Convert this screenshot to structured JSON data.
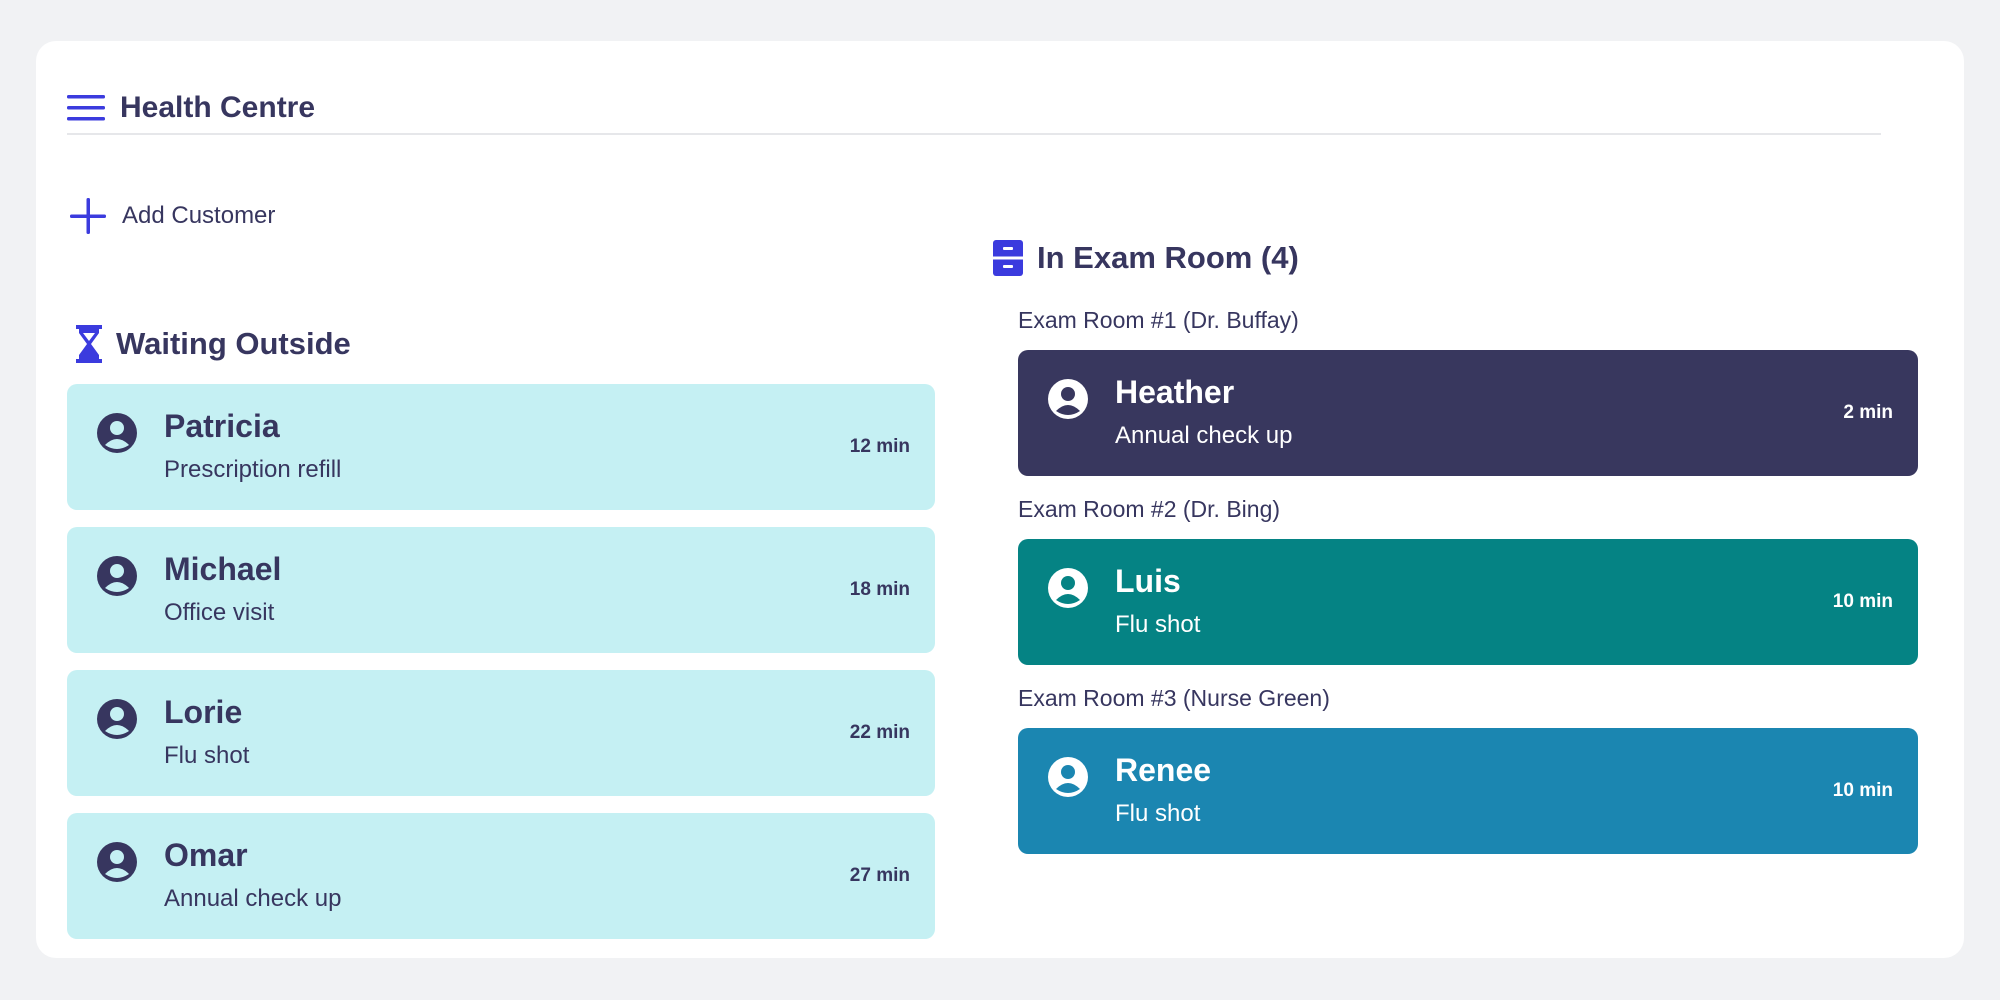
{
  "app": {
    "title": "Health Centre",
    "menu_icon": "hamburger-menu-icon"
  },
  "actions": {
    "add_customer_label": "Add Customer",
    "add_icon": "plus-icon"
  },
  "waiting": {
    "title": "Waiting Outside",
    "icon": "hourglass-icon",
    "patients": [
      {
        "name": "Patricia",
        "reason": "Prescription refill",
        "time": "12 min"
      },
      {
        "name": "Michael",
        "reason": "Office visit",
        "time": "18 min"
      },
      {
        "name": "Lorie",
        "reason": "Flu shot",
        "time": "22 min"
      },
      {
        "name": "Omar",
        "reason": "Annual check up",
        "time": "27 min"
      }
    ]
  },
  "exam": {
    "title": "In Exam Room (4)",
    "icon": "cabinet-icon",
    "rooms": [
      {
        "label": "Exam Room #1 (Dr. Buffay)",
        "color": "#38375e",
        "patient": {
          "name": "Heather",
          "reason": "Annual check up",
          "time": "2 min"
        }
      },
      {
        "label": "Exam Room #2 (Dr. Bing)",
        "color": "#058384",
        "patient": {
          "name": "Luis",
          "reason": "Flu shot",
          "time": "10 min"
        }
      },
      {
        "label": "Exam Room #3 (Nurse Green)",
        "color": "#1b86b1",
        "patient": {
          "name": "Renee",
          "reason": "Flu shot",
          "time": "10 min"
        }
      }
    ]
  },
  "colors": {
    "accent": "#3b3bde",
    "text": "#37365f",
    "waiting_card": "#c5f0f3",
    "background": "#f1f2f4"
  }
}
